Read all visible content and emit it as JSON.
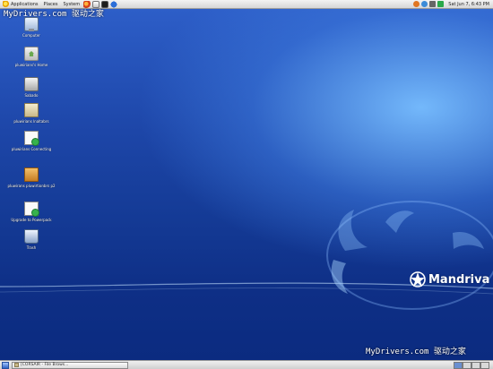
{
  "top_panel": {
    "menus": [
      {
        "label": "Applications",
        "icon": "star-icon"
      },
      {
        "label": "Places"
      },
      {
        "label": "System"
      }
    ],
    "launchers": [
      "firefox-icon",
      "mail-icon",
      "terminal-icon",
      "help-icon"
    ],
    "clock": "Sat Jun 7,  6:43 PM"
  },
  "watermarks": {
    "top": "MyDrivers.com 驱动之家",
    "bottom": "MyDrivers.com 驱动之家"
  },
  "desktop": {
    "icons": [
      {
        "label": "Computer",
        "icon": "computer-icon"
      },
      {
        "label": "pluwirians's Home",
        "icon": "home-folder-icon"
      },
      {
        "label": "Sabado",
        "icon": "drive-icon"
      },
      {
        "label": "pluwirians lnaltabrs",
        "icon": "folder-icon"
      },
      {
        "label": "pluwirians Connecting",
        "icon": "document-icon"
      },
      {
        "label": "pluwirans pluwirtionbrs p2",
        "icon": "package-icon"
      },
      {
        "label": "Upgrade to Powerpack",
        "icon": "upgrade-icon"
      },
      {
        "label": "Trash",
        "icon": "trash-icon"
      }
    ]
  },
  "branding": {
    "logo_text": "Mandriva",
    "logo_icon": "mandriva-star-icon"
  },
  "bottom_panel": {
    "tasks": [
      {
        "label": "[CORSAIR - File Brows..."
      }
    ],
    "workspace_count": 4,
    "active_workspace": 1
  },
  "colors": {
    "panel": "#e4e4e4",
    "desktop_top": "#2d5ec8",
    "desktop_bottom": "#0b2b80",
    "glow": "#78beff"
  }
}
